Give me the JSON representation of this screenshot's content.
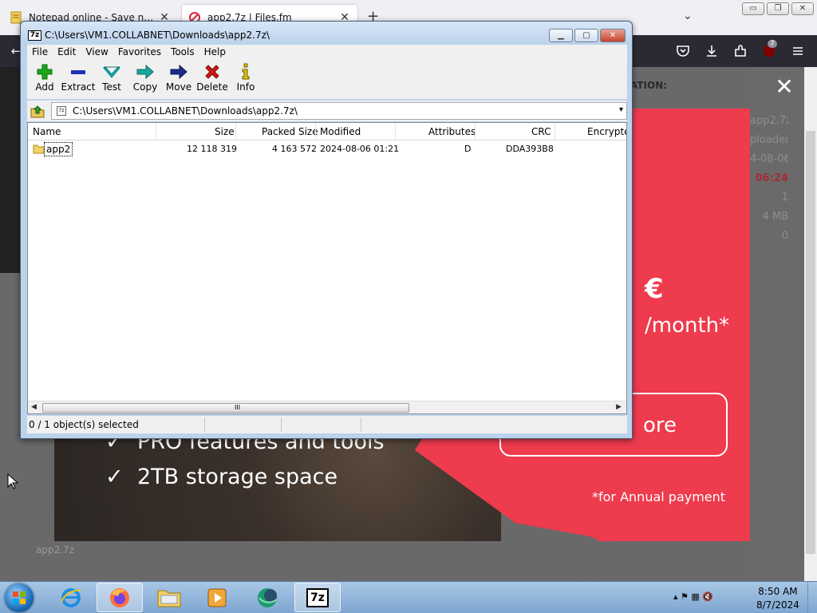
{
  "browser": {
    "tabs": [
      {
        "label": "Notepad online - Save notes online"
      },
      {
        "label": "app2.7z | Files.fm"
      }
    ],
    "new_tab": "+",
    "tab_close": "✕",
    "tab_list": "⌄",
    "window_controls": {
      "minimize": "▭",
      "restore": "❐",
      "close": "✕"
    },
    "extension_badge": "7",
    "page_right_texts": [
      "app2.7z",
      "ploaded",
      "4-08-06",
      "06:24",
      "1",
      "4 MB",
      "0"
    ],
    "ribbon_text": "ATION:",
    "filename_caption": "app2.7z"
  },
  "promo": {
    "price_currency": "€",
    "price_period": "/month*",
    "cta": "ore",
    "features": [
      "PRO features and tools",
      "2TB storage space"
    ],
    "footnote": "*for Annual payment",
    "close": "✕",
    "check": "✓"
  },
  "sevenzip": {
    "icon_label": "7z",
    "title": "C:\\Users\\VM1.COLLABNET\\Downloads\\app2.7z\\",
    "controls": {
      "minimize": "▁",
      "maximize": "▢",
      "close": "✕"
    },
    "menu": [
      "File",
      "Edit",
      "View",
      "Favorites",
      "Tools",
      "Help"
    ],
    "toolbar": [
      {
        "id": "add",
        "label": "Add",
        "icon": "plus-icon",
        "color": "#19a619"
      },
      {
        "id": "extract",
        "label": "Extract",
        "icon": "minus-icon",
        "color": "#1f32b8"
      },
      {
        "id": "test",
        "label": "Test",
        "icon": "check-icon",
        "color": "#16b3b3"
      },
      {
        "id": "copy",
        "label": "Copy",
        "icon": "arrow-right-icon",
        "color": "#18a6a0"
      },
      {
        "id": "move",
        "label": "Move",
        "icon": "arrow-right-icon",
        "color": "#1a2d8a"
      },
      {
        "id": "delete",
        "label": "Delete",
        "icon": "x-icon",
        "color": "#d11616"
      },
      {
        "id": "info",
        "label": "Info",
        "icon": "info-icon",
        "color": "#c9b000"
      }
    ],
    "address": "C:\\Users\\VM1.COLLABNET\\Downloads\\app2.7z\\",
    "address_icon": "7z",
    "address_dropdown": "▾",
    "columns": [
      "Name",
      "Size",
      "Packed Size",
      "Modified",
      "Attributes",
      "CRC",
      "Encrypte"
    ],
    "rows": [
      {
        "name": "app2",
        "size": "12 118 319",
        "packed_size": "4 163 572",
        "modified": "2024-08-06 01:21",
        "attributes": "D",
        "crc": "DDA393B8",
        "encrypted": ""
      }
    ],
    "scroll": {
      "left": "◀",
      "right": "▶",
      "grip": "III"
    },
    "status": "0 / 1 object(s) selected"
  },
  "taskbar": {
    "apps": [
      "internet-explorer",
      "firefox",
      "file-explorer",
      "media-player",
      "app-globe",
      "7-zip"
    ],
    "sevenzip_label": "7z",
    "tray_icons": "▴ ⚑ ▦ 🔇",
    "time": "8:50 AM",
    "date": "8/7/2024"
  },
  "colors": {
    "promo_red": "#ee3b4d",
    "window_frame": "#bcd3ec",
    "browser_nav": "#2b2a33"
  }
}
